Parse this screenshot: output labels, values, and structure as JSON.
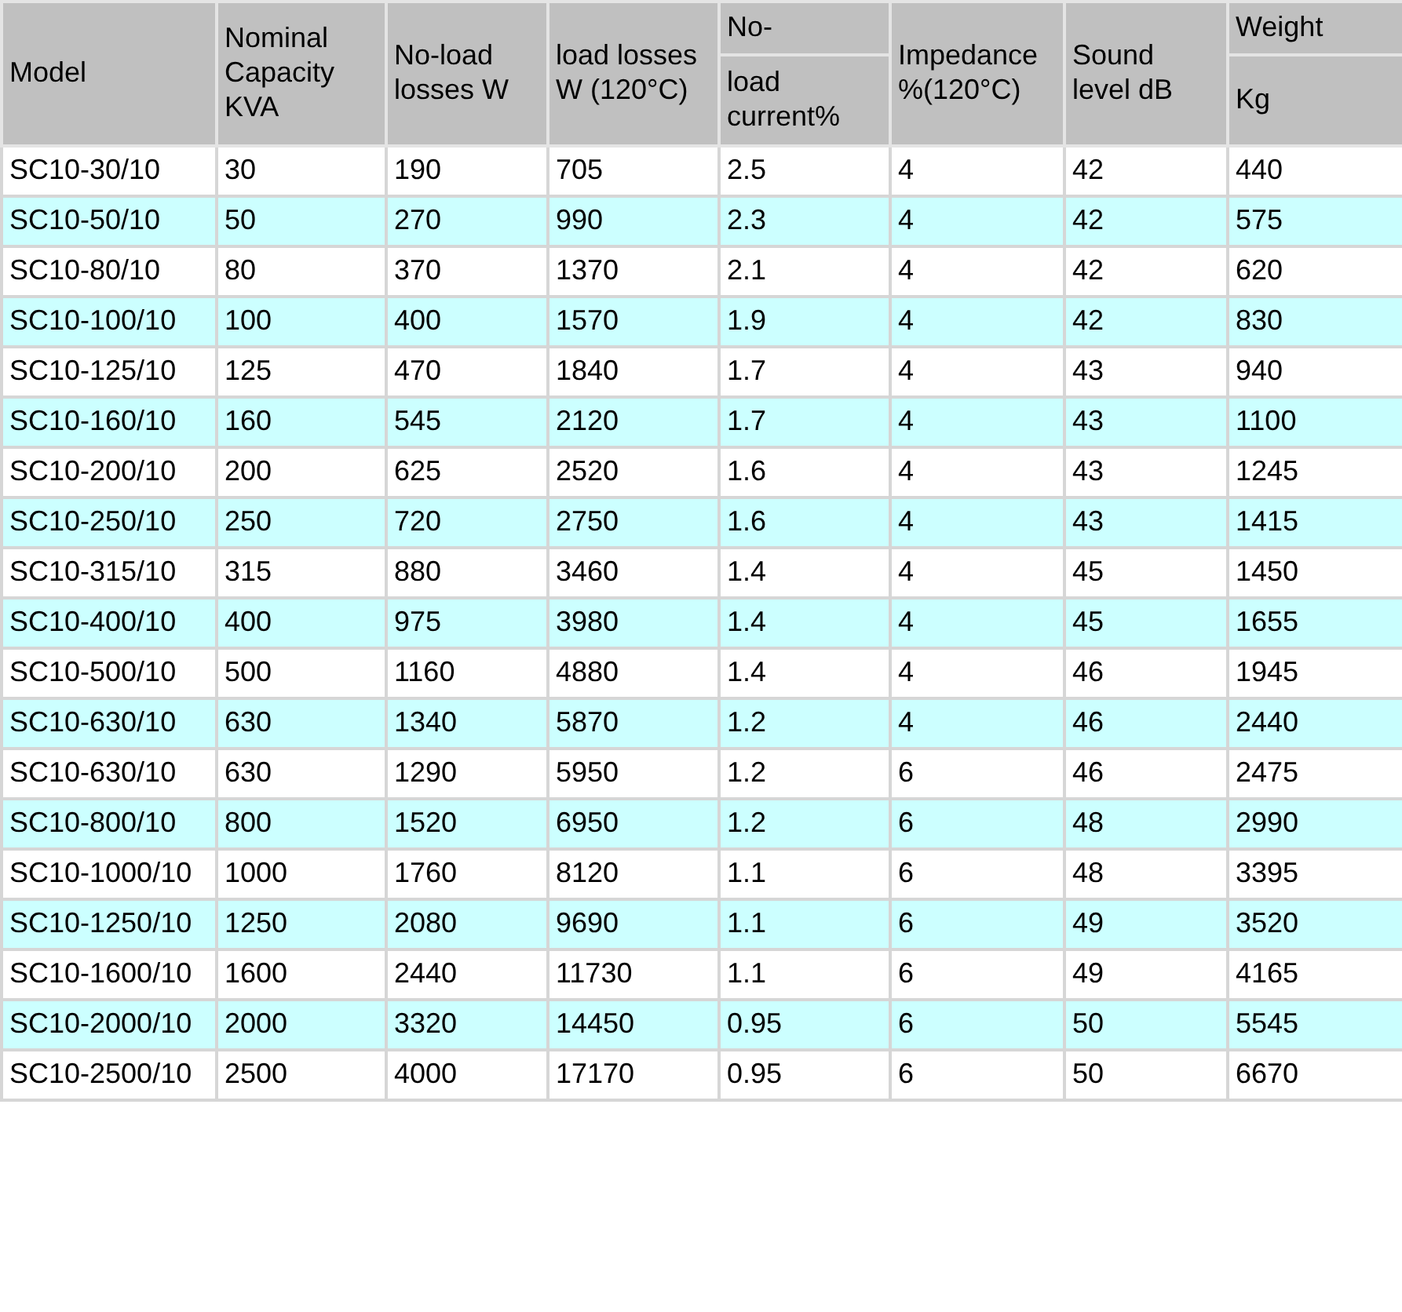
{
  "table": {
    "columns": [
      {
        "label": "Model"
      },
      {
        "label": "Nominal Capacity KVA"
      },
      {
        "label": "No-load losses W"
      },
      {
        "label": "load losses W (120°C)"
      },
      {
        "label": "No-",
        "sublabel": "load current%"
      },
      {
        "label": "Impedance %(120°C)"
      },
      {
        "label": "Sound level dB"
      },
      {
        "label": "Weight",
        "sublabel": "Kg"
      }
    ],
    "rows": [
      [
        "SC10-30/10",
        "30",
        "190",
        "705",
        "2.5",
        "4",
        "42",
        "440"
      ],
      [
        "SC10-50/10",
        "50",
        "270",
        "990",
        "2.3",
        "4",
        "42",
        "575"
      ],
      [
        "SC10-80/10",
        "80",
        "370",
        "1370",
        "2.1",
        "4",
        "42",
        "620"
      ],
      [
        "SC10-100/10",
        "100",
        "400",
        "1570",
        "1.9",
        "4",
        "42",
        "830"
      ],
      [
        "SC10-125/10",
        "125",
        "470",
        "1840",
        "1.7",
        "4",
        "43",
        "940"
      ],
      [
        "SC10-160/10",
        "160",
        "545",
        "2120",
        "1.7",
        "4",
        "43",
        "1100"
      ],
      [
        "SC10-200/10",
        "200",
        "625",
        "2520",
        "1.6",
        "4",
        "43",
        "1245"
      ],
      [
        "SC10-250/10",
        "250",
        "720",
        "2750",
        "1.6",
        "4",
        "43",
        "1415"
      ],
      [
        "SC10-315/10",
        "315",
        "880",
        "3460",
        "1.4",
        "4",
        "45",
        "1450"
      ],
      [
        "SC10-400/10",
        "400",
        "975",
        "3980",
        "1.4",
        "4",
        "45",
        "1655"
      ],
      [
        "SC10-500/10",
        "500",
        "1160",
        "4880",
        "1.4",
        "4",
        "46",
        "1945"
      ],
      [
        "SC10-630/10",
        "630",
        "1340",
        "5870",
        "1.2",
        "4",
        "46",
        "2440"
      ],
      [
        "SC10-630/10",
        "630",
        "1290",
        "5950",
        "1.2",
        "6",
        "46",
        "2475"
      ],
      [
        "SC10-800/10",
        "800",
        "1520",
        "6950",
        "1.2",
        "6",
        "48",
        "2990"
      ],
      [
        "SC10-1000/10",
        "1000",
        "1760",
        "8120",
        "1.1",
        "6",
        "48",
        "3395"
      ],
      [
        "SC10-1250/10",
        "1250",
        "2080",
        "9690",
        "1.1",
        "6",
        "49",
        "3520"
      ],
      [
        "SC10-1600/10",
        "1600",
        "2440",
        "11730",
        "1.1",
        "6",
        "49",
        "4165"
      ],
      [
        "SC10-2000/10",
        "2000",
        "3320",
        "14450",
        "0.95",
        "6",
        "50",
        "5545"
      ],
      [
        "SC10-2500/10",
        "2500",
        "4000",
        "17170",
        "0.95",
        "6",
        "50",
        "6670"
      ]
    ]
  }
}
